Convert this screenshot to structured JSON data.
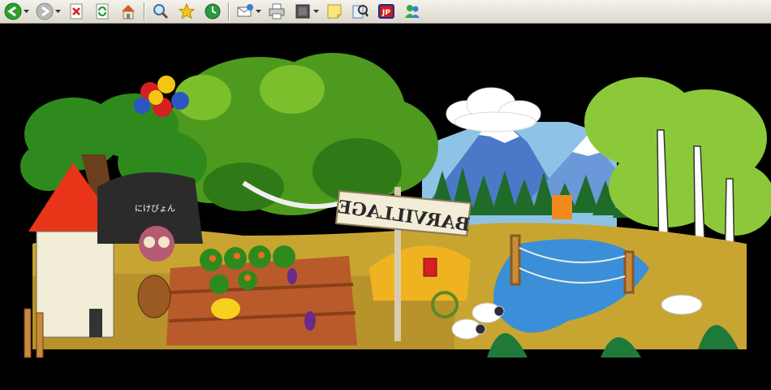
{
  "toolbar": {
    "buttons": [
      {
        "name": "back-button",
        "icon": "back-arrow-icon",
        "dropdown": true
      },
      {
        "name": "forward-button",
        "icon": "forward-arrow-icon",
        "dropdown": true
      },
      {
        "name": "stop-button",
        "icon": "stop-icon"
      },
      {
        "name": "refresh-button",
        "icon": "refresh-icon"
      },
      {
        "name": "home-button",
        "icon": "home-icon"
      },
      {
        "name": "search-button",
        "icon": "search-icon"
      },
      {
        "name": "favorites-button",
        "icon": "star-icon"
      },
      {
        "name": "history-button",
        "icon": "history-icon"
      },
      {
        "name": "mail-button",
        "icon": "mail-icon",
        "dropdown": true
      },
      {
        "name": "print-button",
        "icon": "printer-icon"
      },
      {
        "name": "edit-button",
        "icon": "edit-icon",
        "dropdown": true
      },
      {
        "name": "discuss-button",
        "icon": "note-icon"
      },
      {
        "name": "research-button",
        "icon": "research-icon"
      },
      {
        "name": "jp-button",
        "icon": "jp-icon"
      },
      {
        "name": "messenger-button",
        "icon": "messenger-icon"
      }
    ]
  },
  "scene": {
    "sign_text": "BARVILLAGE",
    "character_label": "にけびょん"
  },
  "colors": {
    "background": "#000000",
    "ground": "#c8a531",
    "sky": "#8ec3e6",
    "water": "#3a8fd8"
  }
}
